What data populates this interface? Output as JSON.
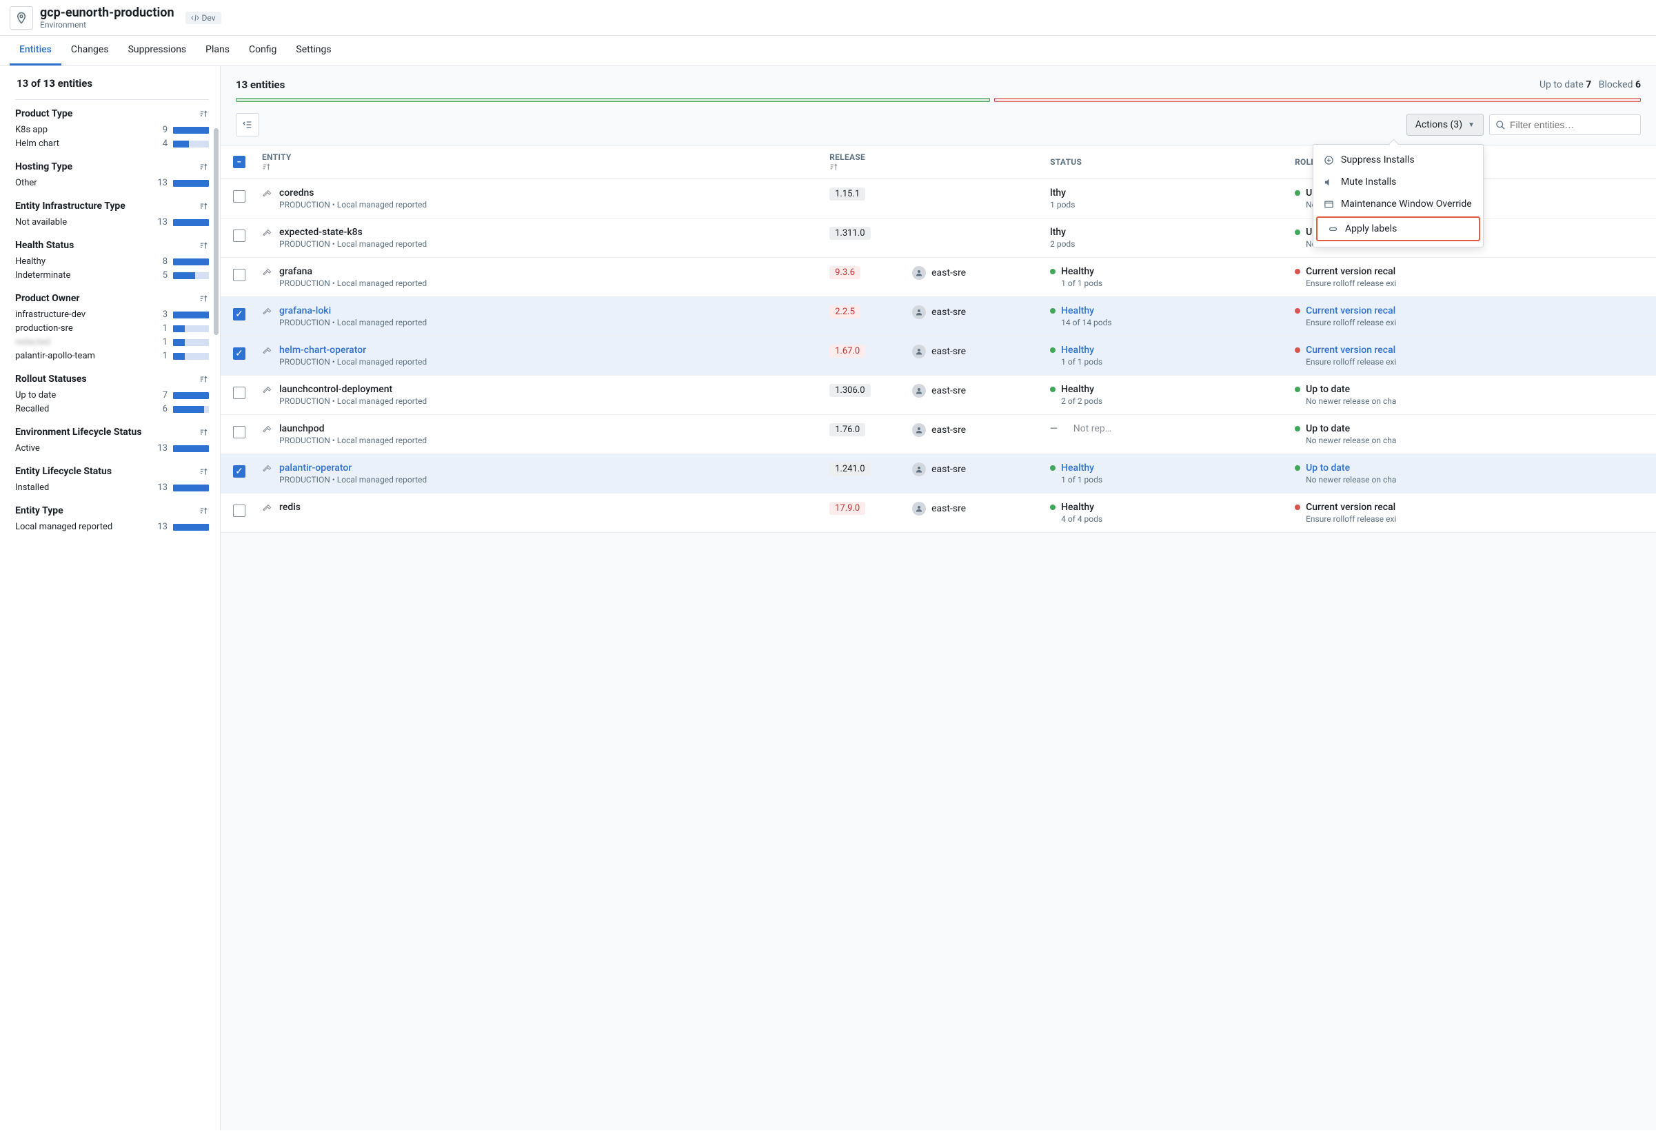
{
  "header": {
    "title": "gcp-eunorth-production",
    "subtitle": "Environment",
    "badge": "Dev"
  },
  "tabs": [
    "Entities",
    "Changes",
    "Suppressions",
    "Plans",
    "Config",
    "Settings"
  ],
  "activeTab": 0,
  "summary": {
    "shown": 13,
    "total": 13,
    "unit": "entities"
  },
  "facets": [
    {
      "title": "Product Type",
      "items": [
        {
          "label": "K8s app",
          "count": 9,
          "pct": 100
        },
        {
          "label": "Helm chart",
          "count": 4,
          "pct": 44
        }
      ]
    },
    {
      "title": "Hosting Type",
      "items": [
        {
          "label": "Other",
          "count": 13,
          "pct": 100
        }
      ]
    },
    {
      "title": "Entity Infrastructure Type",
      "items": [
        {
          "label": "Not available",
          "count": 13,
          "pct": 100
        }
      ]
    },
    {
      "title": "Health Status",
      "items": [
        {
          "label": "Healthy",
          "count": 8,
          "pct": 100
        },
        {
          "label": "Indeterminate",
          "count": 5,
          "pct": 62
        }
      ]
    },
    {
      "title": "Product Owner",
      "items": [
        {
          "label": "infrastructure-dev",
          "count": 3,
          "pct": 100
        },
        {
          "label": "production-sre",
          "count": 1,
          "pct": 33
        },
        {
          "label": "",
          "count": 1,
          "pct": 33,
          "blurred": true
        },
        {
          "label": "palantir-apollo-team",
          "count": 1,
          "pct": 33
        }
      ]
    },
    {
      "title": "Rollout Statuses",
      "items": [
        {
          "label": "Up to date",
          "count": 7,
          "pct": 100
        },
        {
          "label": "Recalled",
          "count": 6,
          "pct": 86
        }
      ]
    },
    {
      "title": "Environment Lifecycle Status",
      "items": [
        {
          "label": "Active",
          "count": 13,
          "pct": 100
        }
      ]
    },
    {
      "title": "Entity Lifecycle Status",
      "items": [
        {
          "label": "Installed",
          "count": 13,
          "pct": 100
        }
      ]
    },
    {
      "title": "Entity Type",
      "items": [
        {
          "label": "Local managed reported",
          "count": 13,
          "pct": 100
        }
      ]
    }
  ],
  "contentHead": {
    "count_label": "13 entities",
    "uptodate_label": "Up to date",
    "uptodate_count": 7,
    "blocked_label": "Blocked",
    "blocked_count": 6
  },
  "toolbar": {
    "actions_label": "Actions (3)",
    "filter_placeholder": "Filter entities…"
  },
  "dropdown": [
    {
      "icon": "plus-circle",
      "label": "Suppress Installs"
    },
    {
      "icon": "mute",
      "label": "Mute Installs"
    },
    {
      "icon": "window",
      "label": "Maintenance Window Override"
    },
    {
      "icon": "tag",
      "label": "Apply labels",
      "highlight": true
    }
  ],
  "columns": [
    "",
    "ENTITY",
    "RELEASE",
    "",
    "STATUS",
    "ROLLOUT STATUS"
  ],
  "rows": [
    {
      "selected": false,
      "name": "coredns",
      "sub": "PRODUCTION • Local managed reported",
      "release": "1.15.1",
      "release_red": false,
      "owner": "",
      "status": "lthy",
      "status_sub": "1 pods",
      "status_partial": true,
      "rollout": "Up to date",
      "rollout_sub": "No newer release on cha",
      "rollout_dot": "green"
    },
    {
      "selected": false,
      "name": "expected-state-k8s",
      "sub": "PRODUCTION • Local managed reported",
      "release": "1.311.0",
      "release_red": false,
      "owner": "",
      "status": "lthy",
      "status_sub": "2 pods",
      "status_partial": true,
      "rollout": "Up to date",
      "rollout_sub": "No newer release on cha",
      "rollout_dot": "green"
    },
    {
      "selected": false,
      "name": "grafana",
      "sub": "PRODUCTION • Local managed reported",
      "release": "9.3.6",
      "release_red": true,
      "owner": "east-sre",
      "status": "Healthy",
      "status_sub": "1 of 1 pods",
      "status_dot": "green",
      "rollout": "Current version recal",
      "rollout_sub": "Ensure rolloff release exi",
      "rollout_dot": "red"
    },
    {
      "selected": true,
      "name": "grafana-loki",
      "sub": "PRODUCTION • Local managed reported",
      "release": "2.2.5",
      "release_red": true,
      "owner": "east-sre",
      "status": "Healthy",
      "status_link": true,
      "status_sub": "14 of 14 pods",
      "status_dot": "green",
      "rollout": "Current version recal",
      "rollout_link": true,
      "rollout_sub": "Ensure rolloff release exi",
      "rollout_dot": "red"
    },
    {
      "selected": true,
      "name": "helm-chart-operator",
      "sub": "PRODUCTION • Local managed reported",
      "release": "1.67.0",
      "release_red": true,
      "owner": "east-sre",
      "status": "Healthy",
      "status_link": true,
      "status_sub": "1 of 1 pods",
      "status_dot": "green",
      "rollout": "Current version recal",
      "rollout_link": true,
      "rollout_sub": "Ensure rolloff release exi",
      "rollout_dot": "red"
    },
    {
      "selected": false,
      "name": "launchcontrol-deployment",
      "sub": "PRODUCTION • Local managed reported",
      "release": "1.306.0",
      "release_red": false,
      "owner": "east-sre",
      "status": "Healthy",
      "status_sub": "2 of 2 pods",
      "status_dot": "green",
      "rollout": "Up to date",
      "rollout_sub": "No newer release on cha",
      "rollout_dot": "green"
    },
    {
      "selected": false,
      "name": "launchpod",
      "sub": "PRODUCTION • Local managed reported",
      "release": "1.76.0",
      "release_red": false,
      "owner": "east-sre",
      "status": "Not rep…",
      "status_notrep": true,
      "rollout": "Up to date",
      "rollout_sub": "No newer release on cha",
      "rollout_dot": "green"
    },
    {
      "selected": true,
      "name": "palantir-operator",
      "sub": "PRODUCTION • Local managed reported",
      "release": "1.241.0",
      "release_red": false,
      "owner": "east-sre",
      "status": "Healthy",
      "status_link": true,
      "status_sub": "1 of 1 pods",
      "status_dot": "green",
      "rollout": "Up to date",
      "rollout_link": true,
      "rollout_sub": "No newer release on cha",
      "rollout_dot": "green"
    },
    {
      "selected": false,
      "name": "redis",
      "sub": "",
      "release": "17.9.0",
      "release_red": true,
      "owner": "east-sre",
      "status": "Healthy",
      "status_sub": "4 of 4 pods",
      "status_dot": "green",
      "rollout": "Current version recal",
      "rollout_sub": "Ensure rolloff release exi",
      "rollout_dot": "red"
    }
  ]
}
